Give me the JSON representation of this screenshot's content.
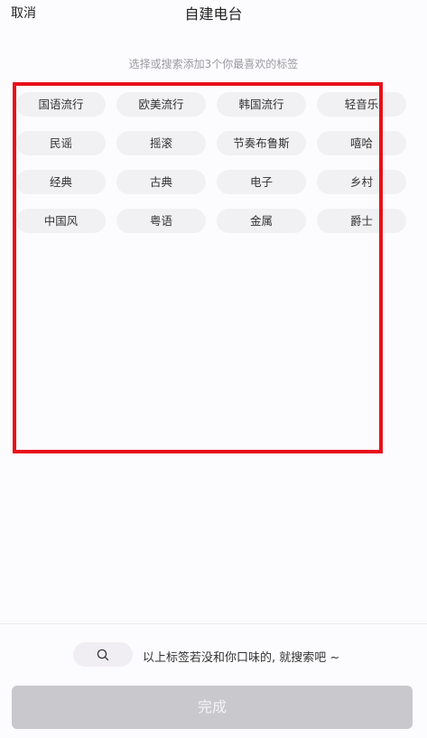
{
  "header": {
    "cancel_label": "取消",
    "title": "自建电台"
  },
  "hint": "选择或搜索添加3个你最喜欢的标签",
  "tags": [
    "国语流行",
    "欧美流行",
    "韩国流行",
    "轻音乐",
    "民谣",
    "摇滚",
    "节奏布鲁斯",
    "嘻哈",
    "经典",
    "古典",
    "电子",
    "乡村",
    "中国风",
    "粤语",
    "金属",
    "爵士"
  ],
  "search": {
    "icon": "search-icon",
    "prompt": "以上标签若没和你口味的, 就搜索吧 ~"
  },
  "done_label": "完成",
  "colors": {
    "highlight_border": "#e8101a",
    "tag_background": "#f1f0f3",
    "done_button": "#c9c8cd"
  }
}
